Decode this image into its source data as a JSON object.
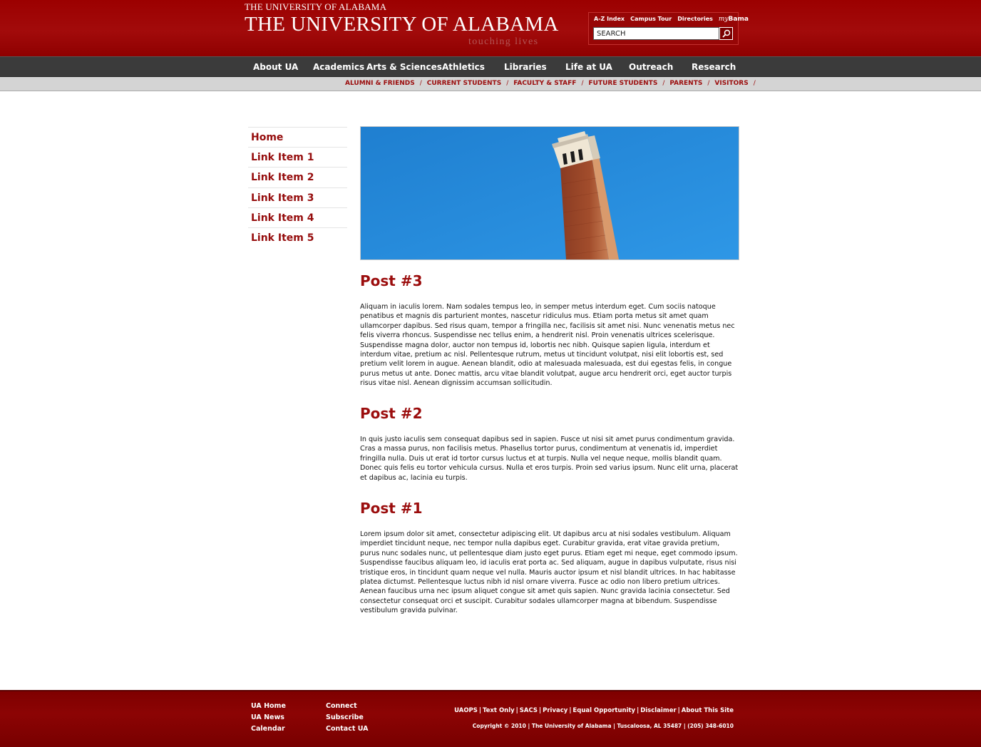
{
  "header": {
    "small_logo": "THE UNIVERSITY OF ALABAMA",
    "logo": "THE UNIVERSITY OF ALABAMA",
    "tagline": "touching lives",
    "util_links": [
      "A-Z Index",
      "Campus Tour",
      "Directories"
    ],
    "mybama_prefix": "my",
    "mybama_suffix": "Bama",
    "search_placeholder": "SEARCH",
    "search_icon": "magnifier-icon"
  },
  "main_nav": [
    "About UA",
    "Academics",
    "Arts & Sciences",
    "Athletics",
    "Libraries",
    "Life at UA",
    "Outreach",
    "Research"
  ],
  "audience_nav": [
    "ALUMNI & FRIENDS",
    "CURRENT STUDENTS",
    "FACULTY & STAFF",
    "FUTURE STUDENTS",
    "PARENTS",
    "VISITORS"
  ],
  "audience_separator": "/",
  "sidebar": [
    "Home",
    "Link Item 1",
    "Link Item 2",
    "Link Item 3",
    "Link Item 4",
    "Link Item 5"
  ],
  "hero": {
    "description_icon": "bell-tower-photo"
  },
  "posts": [
    {
      "title": "Post #3",
      "body": "Aliquam in iaculis lorem. Nam sodales tempus leo, in semper metus interdum eget. Cum sociis natoque penatibus et magnis dis parturient montes, nascetur ridiculus mus. Etiam porta metus sit amet quam ullamcorper dapibus. Sed risus quam, tempor a fringilla nec, facilisis sit amet nisi. Nunc venenatis metus nec felis viverra rhoncus. Suspendisse nec tellus enim, a hendrerit nisl. Proin venenatis ultrices scelerisque. Suspendisse magna dolor, auctor non tempus id, lobortis nec nibh. Quisque sapien ligula, interdum et interdum vitae, pretium ac nisl. Pellentesque rutrum, metus ut tincidunt volutpat, nisi elit lobortis est, sed pretium velit lorem in augue. Aenean blandit, odio at malesuada malesuada, est dui egestas felis, in congue purus metus ut ante. Donec mattis, arcu vitae blandit volutpat, augue arcu hendrerit orci, eget auctor turpis risus vitae nisl. Aenean dignissim accumsan sollicitudin."
    },
    {
      "title": "Post #2",
      "body": "In quis justo iaculis sem consequat dapibus sed in sapien. Fusce ut nisi sit amet purus condimentum gravida. Cras a massa purus, non facilisis metus. Phasellus tortor purus, condimentum at venenatis id, imperdiet fringilla nulla. Duis ut erat id tortor cursus luctus et at turpis. Nulla vel neque neque, mollis blandit quam. Donec quis felis eu tortor vehicula cursus. Nulla et eros turpis. Proin sed varius ipsum. Nunc elit urna, placerat et dapibus ac, lacinia eu turpis."
    },
    {
      "title": "Post #1",
      "body": "Lorem ipsum dolor sit amet, consectetur adipiscing elit. Ut dapibus arcu at nisi sodales vestibulum. Aliquam imperdiet tincidunt neque, nec tempor nulla dapibus eget. Curabitur gravida, erat vitae gravida pretium, purus nunc sodales nunc, ut pellentesque diam justo eget purus. Etiam eget mi neque, eget commodo ipsum. Suspendisse faucibus aliquam leo, id iaculis erat porta ac. Sed aliquam, augue in dapibus vulputate, risus nisi tristique eros, in tincidunt quam neque vel nulla. Mauris auctor ipsum et nisl blandit ultrices. In hac habitasse platea dictumst. Pellentesque luctus nibh id nisl ornare viverra. Fusce ac odio non libero pretium ultrices. Aenean faucibus urna nec ipsum aliquet congue sit amet quis sapien. Nunc gravida lacinia consectetur. Sed consectetur consequat orci et suscipit. Curabitur sodales ullamcorper magna at bibendum. Suspendisse vestibulum gravida pulvinar."
    }
  ],
  "footer": {
    "col1": [
      "UA Home",
      "UA News",
      "Calendar"
    ],
    "col2": [
      "Connect",
      "Subscribe",
      "Contact UA"
    ],
    "legal": [
      "UAOPS",
      "Text Only",
      "SACS",
      "Privacy",
      "Equal Opportunity",
      "Disclaimer",
      "About This Site"
    ],
    "legal_separator": "|",
    "copyright": "Copyright © 2010 | The University of Alabama | Tuscaloosa, AL 35487 | (205) 348-6010"
  },
  "colors": {
    "brand_red": "#9c0000",
    "nav_dark": "#3b3b3b",
    "audience_bar": "#d4d4d4",
    "heading_red": "#9b0d0d"
  }
}
